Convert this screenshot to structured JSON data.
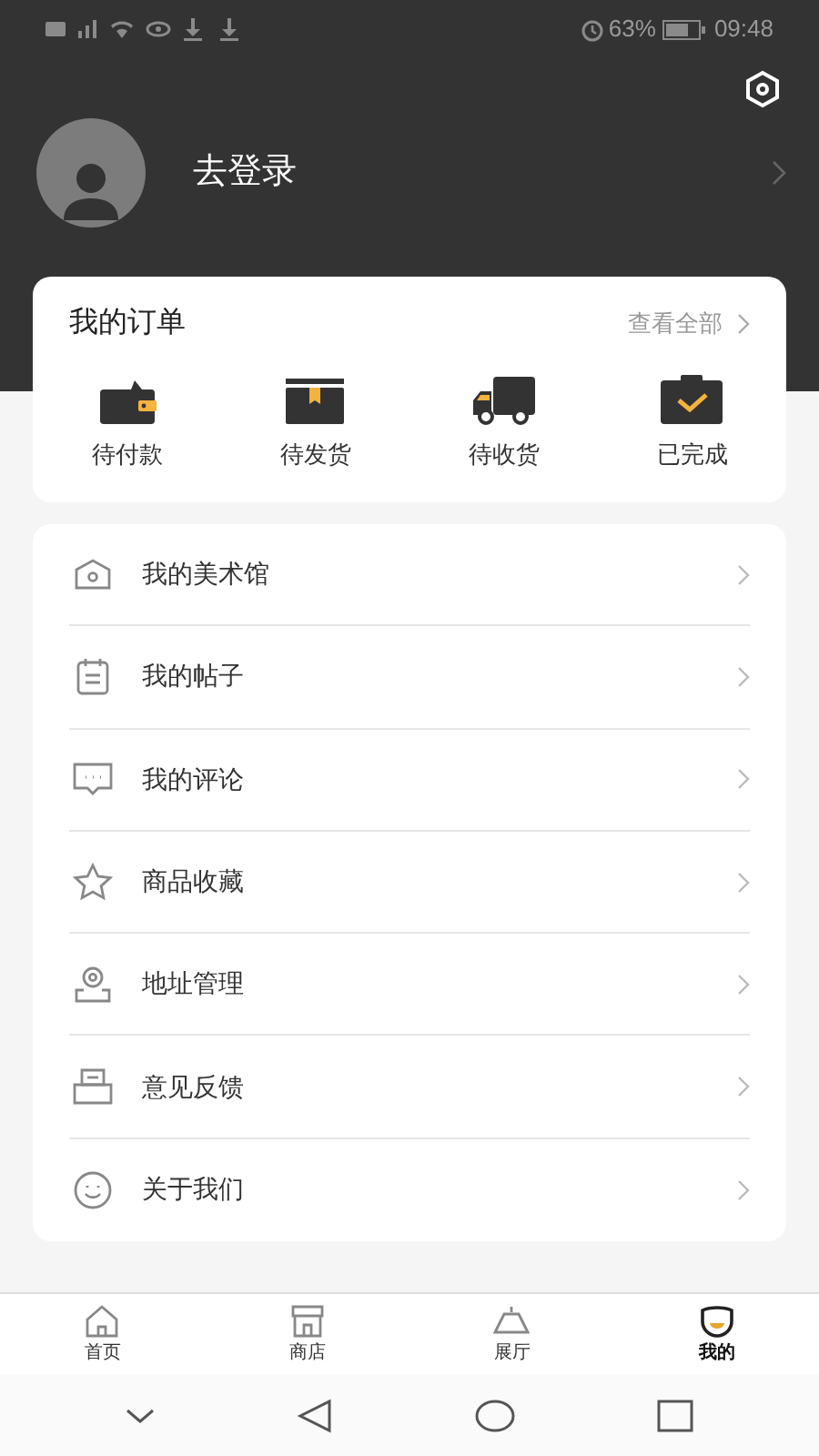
{
  "status_bar": {
    "battery": "63%",
    "time": "09:48"
  },
  "profile": {
    "login": "去登录"
  },
  "orders": {
    "title": "我的订单",
    "view_all": "查看全部",
    "items": [
      {
        "kind": "wallet",
        "label": "待付款"
      },
      {
        "kind": "box",
        "label": "待发货"
      },
      {
        "kind": "truck",
        "label": "待收货"
      },
      {
        "kind": "done",
        "label": "已完成"
      }
    ]
  },
  "menu": [
    {
      "kind": "gallery",
      "label": "我的美术馆"
    },
    {
      "kind": "post",
      "label": "我的帖子"
    },
    {
      "kind": "comment",
      "label": "我的评论"
    },
    {
      "kind": "star",
      "label": "商品收藏"
    },
    {
      "kind": "address",
      "label": "地址管理"
    },
    {
      "kind": "feedback",
      "label": "意见反馈"
    },
    {
      "kind": "about",
      "label": "关于我们"
    }
  ],
  "tabs": [
    {
      "kind": "home",
      "label": "首页",
      "selected": false
    },
    {
      "kind": "shop",
      "label": "商店",
      "selected": false
    },
    {
      "kind": "hall",
      "label": "展厅",
      "selected": false
    },
    {
      "kind": "me",
      "label": "我的",
      "selected": true
    }
  ]
}
